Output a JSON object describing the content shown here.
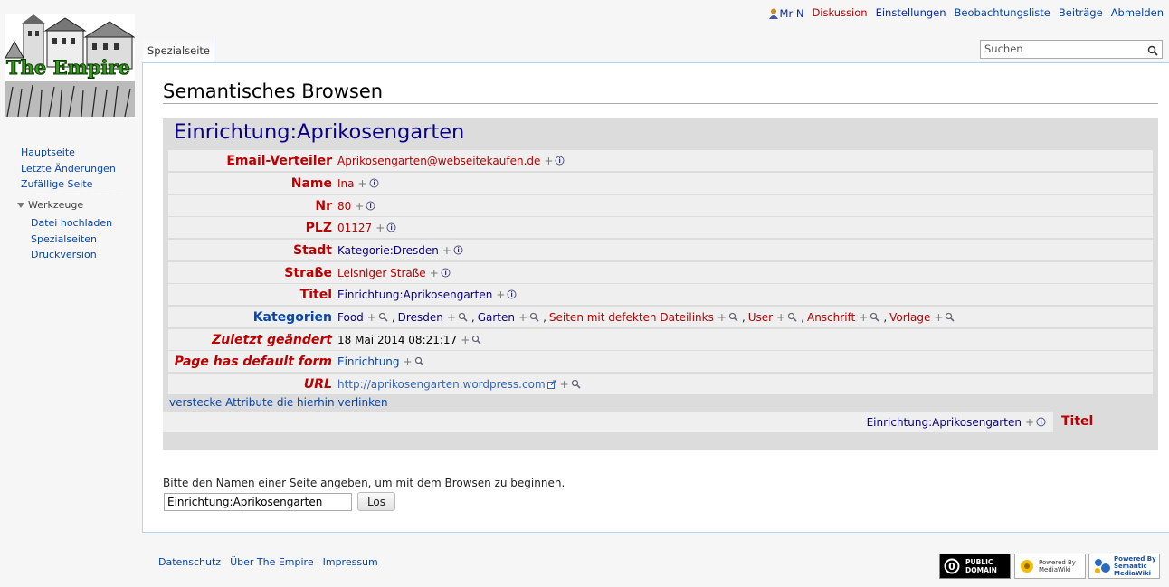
{
  "logo": {
    "text": "The Empire"
  },
  "personal_tools": {
    "user": "Mr N",
    "discussion": "Diskussion",
    "settings": "Einstellungen",
    "watchlist": "Beobachtungsliste",
    "contributions": "Beiträge",
    "logout": "Abmelden"
  },
  "tab": {
    "label": "Spezialseite"
  },
  "search": {
    "placeholder": "Suchen"
  },
  "page_title": "Semantisches Browsen",
  "browse": {
    "subject": "Einrichtung:Aprikosengarten",
    "rows": [
      {
        "prop": "Email-Verteiler",
        "value": "Aprikosengarten@webseitekaufen.de"
      },
      {
        "prop": "Name",
        "value": "Ina"
      },
      {
        "prop": "Nr",
        "value": "80"
      },
      {
        "prop": "PLZ",
        "value": "01127"
      },
      {
        "prop": "Stadt",
        "value": "Kategorie:Dresden"
      },
      {
        "prop": "Straße",
        "value": "Leisniger Straße"
      },
      {
        "prop": "Titel",
        "value": "Einrichtung:Aprikosengarten"
      },
      {
        "prop": "Kategorien",
        "values": [
          "Food",
          "Dresden",
          "Garten",
          "Seiten mit defekten Dateilinks",
          "User",
          "Anschrift",
          "Vorlage"
        ]
      },
      {
        "prop": "Zuletzt geändert",
        "value": "18 Mai 2014 08:21:17"
      },
      {
        "prop": "Page has default form",
        "value": "Einrichtung"
      },
      {
        "prop": "URL",
        "value": "http://aprikosengarten.wordpress.com"
      }
    ],
    "hide_incoming": "verstecke Attribute die hierhin verlinken",
    "incoming": {
      "value": "Einrichtung:Aprikosengarten",
      "prop": "Titel"
    }
  },
  "form": {
    "prompt": "Bitte den Namen einer Seite angeben, um mit dem Browsen zu beginnen.",
    "input_value": "Einrichtung:Aprikosengarten",
    "button": "Los"
  },
  "sidebar": {
    "nav": [
      "Hauptseite",
      "Letzte Änderungen",
      "Zufällige Seite"
    ],
    "tools_heading": "Werkzeuge",
    "tools": [
      "Datei hochladen",
      "Spezialseiten",
      "Druckversion"
    ]
  },
  "footer": {
    "links": [
      "Datenschutz",
      "Über The Empire",
      "Impressum"
    ],
    "badges": [
      "PUBLIC DOMAIN",
      "Powered By MediaWiki",
      "Powered By Semantic MediaWiki"
    ]
  },
  "colors": {
    "red_link": "#ba0000",
    "link": "#0645ad",
    "visited": "#0b0080",
    "border": "#a7d7f9"
  }
}
